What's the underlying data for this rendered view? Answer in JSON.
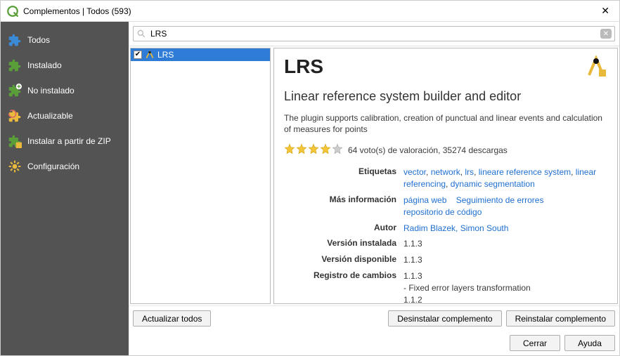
{
  "window": {
    "title": "Complementos | Todos (593)"
  },
  "sidebar": {
    "items": [
      {
        "label": "Todos"
      },
      {
        "label": "Instalado"
      },
      {
        "label": "No instalado"
      },
      {
        "label": "Actualizable"
      },
      {
        "label": "Instalar a partir de ZIP"
      },
      {
        "label": "Configuración"
      }
    ]
  },
  "search": {
    "value": "LRS"
  },
  "list": {
    "items": [
      {
        "label": "LRS",
        "checked": true,
        "selected": true
      }
    ]
  },
  "detail": {
    "name": "LRS",
    "subtitle": "Linear reference system builder and editor",
    "description": "The plugin supports calibration, creation of punctual and linear events and calculation of measures for points",
    "rating": {
      "filled": 4,
      "total": 5,
      "votes_text": "64 voto(s) de valoración, 35274 descargas"
    },
    "labels": {
      "tags": "Etiquetas",
      "more_info": "Más información",
      "author": "Autor",
      "installed_version": "Versión instalada",
      "available_version": "Versión disponible",
      "changelog": "Registro de cambios"
    },
    "tags": [
      "vector",
      "network",
      "lrs",
      "lineare reference system",
      "linear referencing",
      "dynamic segmentation"
    ],
    "more_info": [
      "página web",
      "Seguimiento de errores",
      "repositorio de código"
    ],
    "author": "Radim Blazek, Simon South",
    "installed_version": "1.1.3",
    "available_version": "1.1.3",
    "changelog_lines": [
      "1.1.3",
      "- Fixed error layers transformation",
      "1.1.2"
    ]
  },
  "buttons": {
    "update_all": "Actualizar todos",
    "uninstall": "Desinstalar complemento",
    "reinstall": "Reinstalar complemento",
    "close": "Cerrar",
    "help": "Ayuda"
  }
}
